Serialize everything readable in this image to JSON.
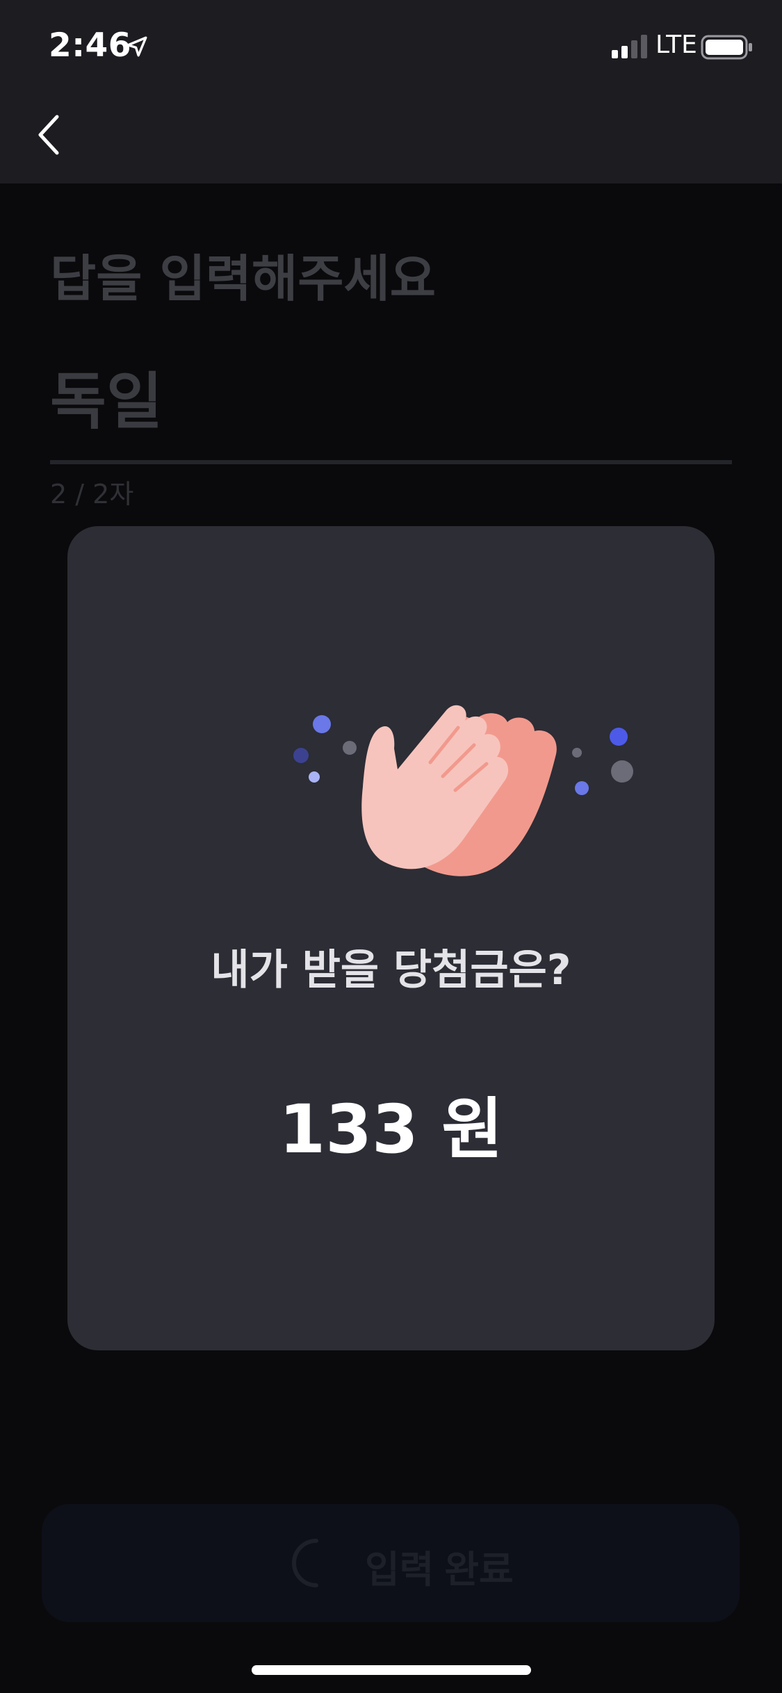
{
  "status_bar": {
    "time": "2:46",
    "network": "LTE",
    "icons": [
      "location-arrow-icon",
      "signal-icon",
      "battery-icon"
    ]
  },
  "nav": {
    "back_icon": "chevron-left-icon"
  },
  "page": {
    "title": "답을 입력해주세요",
    "answer_value": "독일",
    "char_counter": "2 / 2자"
  },
  "modal": {
    "illustration": "clapping-hands-icon",
    "question": "내가 받을 당첨금은?",
    "prize": "133 원"
  },
  "submit": {
    "label": "입력 완료",
    "icon": "spinner-icon"
  },
  "colors": {
    "header_bg": "#1c1c21",
    "page_bg": "#0a0a0c",
    "modal_bg": "#2c2d35",
    "hand_front": "#f6c4bd",
    "hand_back": "#f2998d",
    "dot_blue": "#6a78e8",
    "dot_gray": "#6b6c78"
  }
}
